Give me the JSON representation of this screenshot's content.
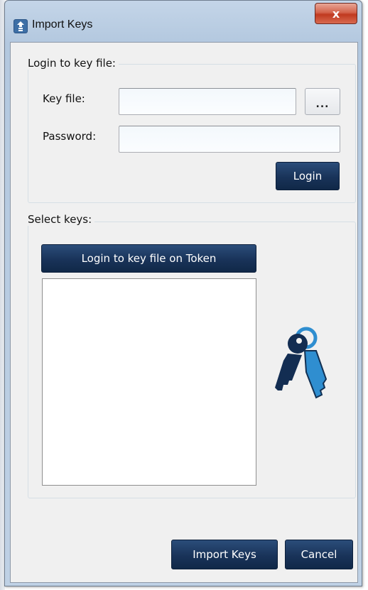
{
  "window": {
    "title": "Import Keys",
    "close_label": "x"
  },
  "login_group": {
    "legend": "Login to key file:",
    "key_file_label": "Key file:",
    "key_file_value": "",
    "browse_label": "...",
    "password_label": "Password:",
    "password_value": "",
    "login_button": "Login"
  },
  "select_group": {
    "legend": "Select keys:",
    "token_button": "Login to key file on Token",
    "keys_list": [],
    "icon": "keys-icon"
  },
  "footer": {
    "import_button": "Import Keys",
    "cancel_button": "Cancel"
  },
  "colors": {
    "accent_navy": "#193359",
    "keys_dark": "#132d52",
    "keys_light": "#2f8ed0"
  }
}
